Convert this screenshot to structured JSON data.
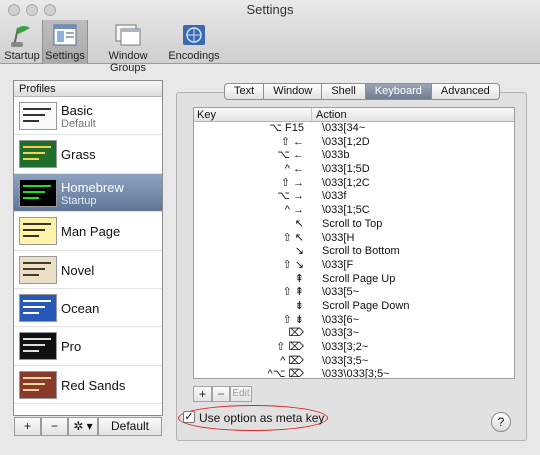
{
  "window": {
    "title": "Settings"
  },
  "toolbar": [
    {
      "label": "Startup",
      "icon": "switch-flag-icon"
    },
    {
      "label": "Settings",
      "icon": "settings-window-icon",
      "active": true
    },
    {
      "label": "Window Groups",
      "icon": "window-groups-icon"
    },
    {
      "label": "Encodings",
      "icon": "globe-encodings-icon"
    }
  ],
  "profiles": {
    "header": "Profiles",
    "items": [
      {
        "name": "Basic",
        "sub": "Default",
        "thumb": "#fafafa",
        "text": "#333"
      },
      {
        "name": "Grass",
        "sub": "",
        "thumb": "#1f6e2e",
        "text": "#f5d24a"
      },
      {
        "name": "Homebrew",
        "sub": "Startup",
        "thumb": "#000000",
        "text": "#1ee01e",
        "selected": true
      },
      {
        "name": "Man Page",
        "sub": "",
        "thumb": "#fff3a8",
        "text": "#333"
      },
      {
        "name": "Novel",
        "sub": "",
        "thumb": "#e9dfc5",
        "text": "#4a3a2a"
      },
      {
        "name": "Ocean",
        "sub": "",
        "thumb": "#2859b8",
        "text": "#ffffff"
      },
      {
        "name": "Pro",
        "sub": "",
        "thumb": "#111111",
        "text": "#dddddd"
      },
      {
        "name": "Red Sands",
        "sub": "",
        "thumb": "#8a3a2a",
        "text": "#f0d7a0"
      }
    ],
    "buttons": {
      "add": "+",
      "remove": "−",
      "gear": "✲ ▾",
      "default": "Default"
    }
  },
  "tabs": [
    "Text",
    "Window",
    "Shell",
    "Keyboard",
    "Advanced"
  ],
  "active_tab": "Keyboard",
  "keyboard": {
    "columns": {
      "key": "Key",
      "action": "Action"
    },
    "rows": [
      {
        "key": "⌥ F15",
        "action": "\\033[34~"
      },
      {
        "key": "⇧ ←",
        "action": "\\033[1;2D"
      },
      {
        "key": "⌥ ←",
        "action": "\\033b"
      },
      {
        "key": "^ ←",
        "action": "\\033[1;5D"
      },
      {
        "key": "⇧ →",
        "action": "\\033[1;2C"
      },
      {
        "key": "⌥ →",
        "action": "\\033f"
      },
      {
        "key": "^ →",
        "action": "\\033[1;5C"
      },
      {
        "key": "↖",
        "action": "Scroll to Top"
      },
      {
        "key": "⇧ ↖",
        "action": "\\033[H"
      },
      {
        "key": "↘",
        "action": "Scroll to Bottom"
      },
      {
        "key": "⇧ ↘",
        "action": "\\033[F"
      },
      {
        "key": "⇞",
        "action": "Scroll Page Up"
      },
      {
        "key": "⇧ ⇞",
        "action": "\\033[5~"
      },
      {
        "key": "⇟",
        "action": "Scroll Page Down"
      },
      {
        "key": "⇧ ⇟",
        "action": "\\033[6~"
      },
      {
        "key": "⌦",
        "action": "\\033[3~"
      },
      {
        "key": "⇧ ⌦",
        "action": "\\033[3;2~"
      },
      {
        "key": "^ ⌦",
        "action": "\\033[3;5~"
      },
      {
        "key": "^⌥ ⌦",
        "action": "\\033\\033[3;5~"
      }
    ],
    "buttons": {
      "add": "+",
      "remove": "−",
      "edit": "Edit"
    }
  },
  "option_meta": {
    "label": "Use option as meta key",
    "checked": true
  },
  "help": "?"
}
